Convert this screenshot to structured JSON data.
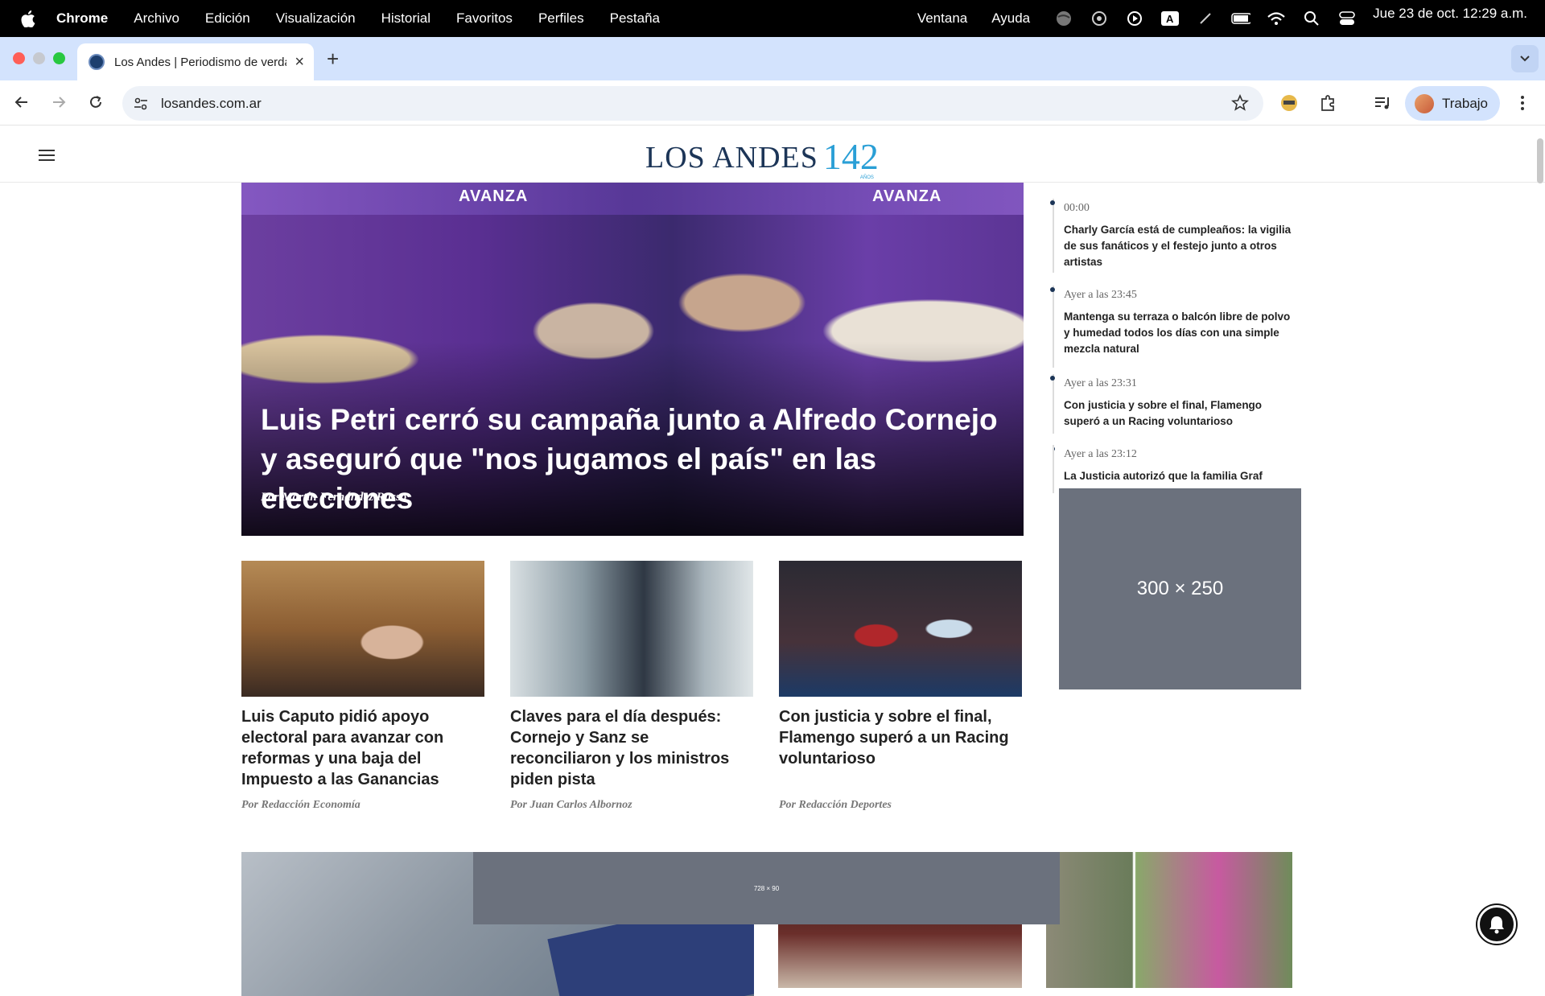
{
  "menubar": {
    "app": "Chrome",
    "items": [
      "Archivo",
      "Edición",
      "Visualización",
      "Historial",
      "Favoritos",
      "Perfiles",
      "Pestaña"
    ],
    "right_items": [
      "Ventana",
      "Ayuda"
    ],
    "clock": "Jue 23 de oct.  12:29 a.m."
  },
  "browser": {
    "tab_title": "Los Andes | Periodismo de verdad",
    "url": "losandes.com.ar",
    "profile_label": "Trabajo"
  },
  "site": {
    "logo_text": "LOS ANDES",
    "logo_number": "142",
    "logo_sub": "AÑOS"
  },
  "hero": {
    "banner_text_1": "AVANZA",
    "banner_text_2": "AVANZA",
    "headline": "Luis Petri cerró su campaña junto a Alfredo Cornejo y aseguró que \"nos jugamos el país\" en las elecciones",
    "byline": "Por Martín Fernández Russo"
  },
  "cards": [
    {
      "title": "Luis Caputo pidió apoyo electoral para avanzar con reformas y una baja del Impuesto a las Ganancias",
      "byline": "Por Redacción Economía"
    },
    {
      "title": "Claves para el día después: Cornejo y Sanz se reconciliaron y los ministros piden pista",
      "byline": "Por Juan Carlos Albornoz"
    },
    {
      "title": "Con justicia y sobre el final, Flamengo superó a un Racing voluntarioso",
      "byline": "Por Redacción Deportes"
    }
  ],
  "feed": [
    {
      "time": "00:00",
      "text": "Charly García está de cumpleaños: la vigilia de sus fanáticos y el festejo junto a otros artistas"
    },
    {
      "time": "Ayer a las 23:45",
      "text": "Mantenga su terraza o balcón libre de polvo y humedad todos los días con una simple mezcla natural"
    },
    {
      "time": "Ayer a las 23:31",
      "text": "Con justicia y sobre el final, Flamengo superó a un Racing voluntarioso"
    },
    {
      "time": "Ayer a las 23:12",
      "text": "La Justicia autorizó que la familia Graf"
    }
  ],
  "ads": {
    "side_label": "300 × 250",
    "leader_label": "728 × 90"
  }
}
